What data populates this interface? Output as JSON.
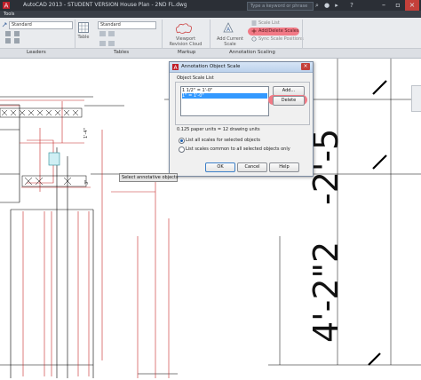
{
  "titlebar": {
    "title": "AutoCAD 2013 - STUDENT VERSION    House Plan - 2ND FL.dwg",
    "search_placeholder": "Type a keyword or phrase"
  },
  "ribbon": {
    "tab": "Tools",
    "leaders_style": "Standard",
    "tables_style": "Standard",
    "buttons": {
      "table": "Table",
      "viewport_revision_cloud": "Viewport Revision Cloud",
      "add_current_scale": "Add Current Scale",
      "scale_list": "Scale List",
      "add_delete_scales": "Add/Delete Scales",
      "sync_scale_positions": "Sync Scale Positions"
    },
    "panels": [
      "Leaders",
      "Tables",
      "Markup",
      "Annotation Scaling"
    ]
  },
  "dialog": {
    "title": "Annotation Object Scale",
    "group_label": "Object Scale List",
    "scales": [
      "1 1/2\" = 1'-0\"",
      "1\" = 1'-0\""
    ],
    "selected_index": 1,
    "add_label": "Add...",
    "delete_label": "Delete",
    "units_text": "0.125  paper units = 12  drawing units",
    "radio_all": "List all scales for selected objects",
    "radio_common": "List scales common to all selected objects only",
    "radio_selected": "all",
    "ok": "OK",
    "cancel": "Cancel",
    "help": "Help"
  },
  "tooltip": "Select annotative objects",
  "colors": {
    "highlight": "#f27a86",
    "selection": "#3399ff",
    "accent": "#c91f1f"
  }
}
